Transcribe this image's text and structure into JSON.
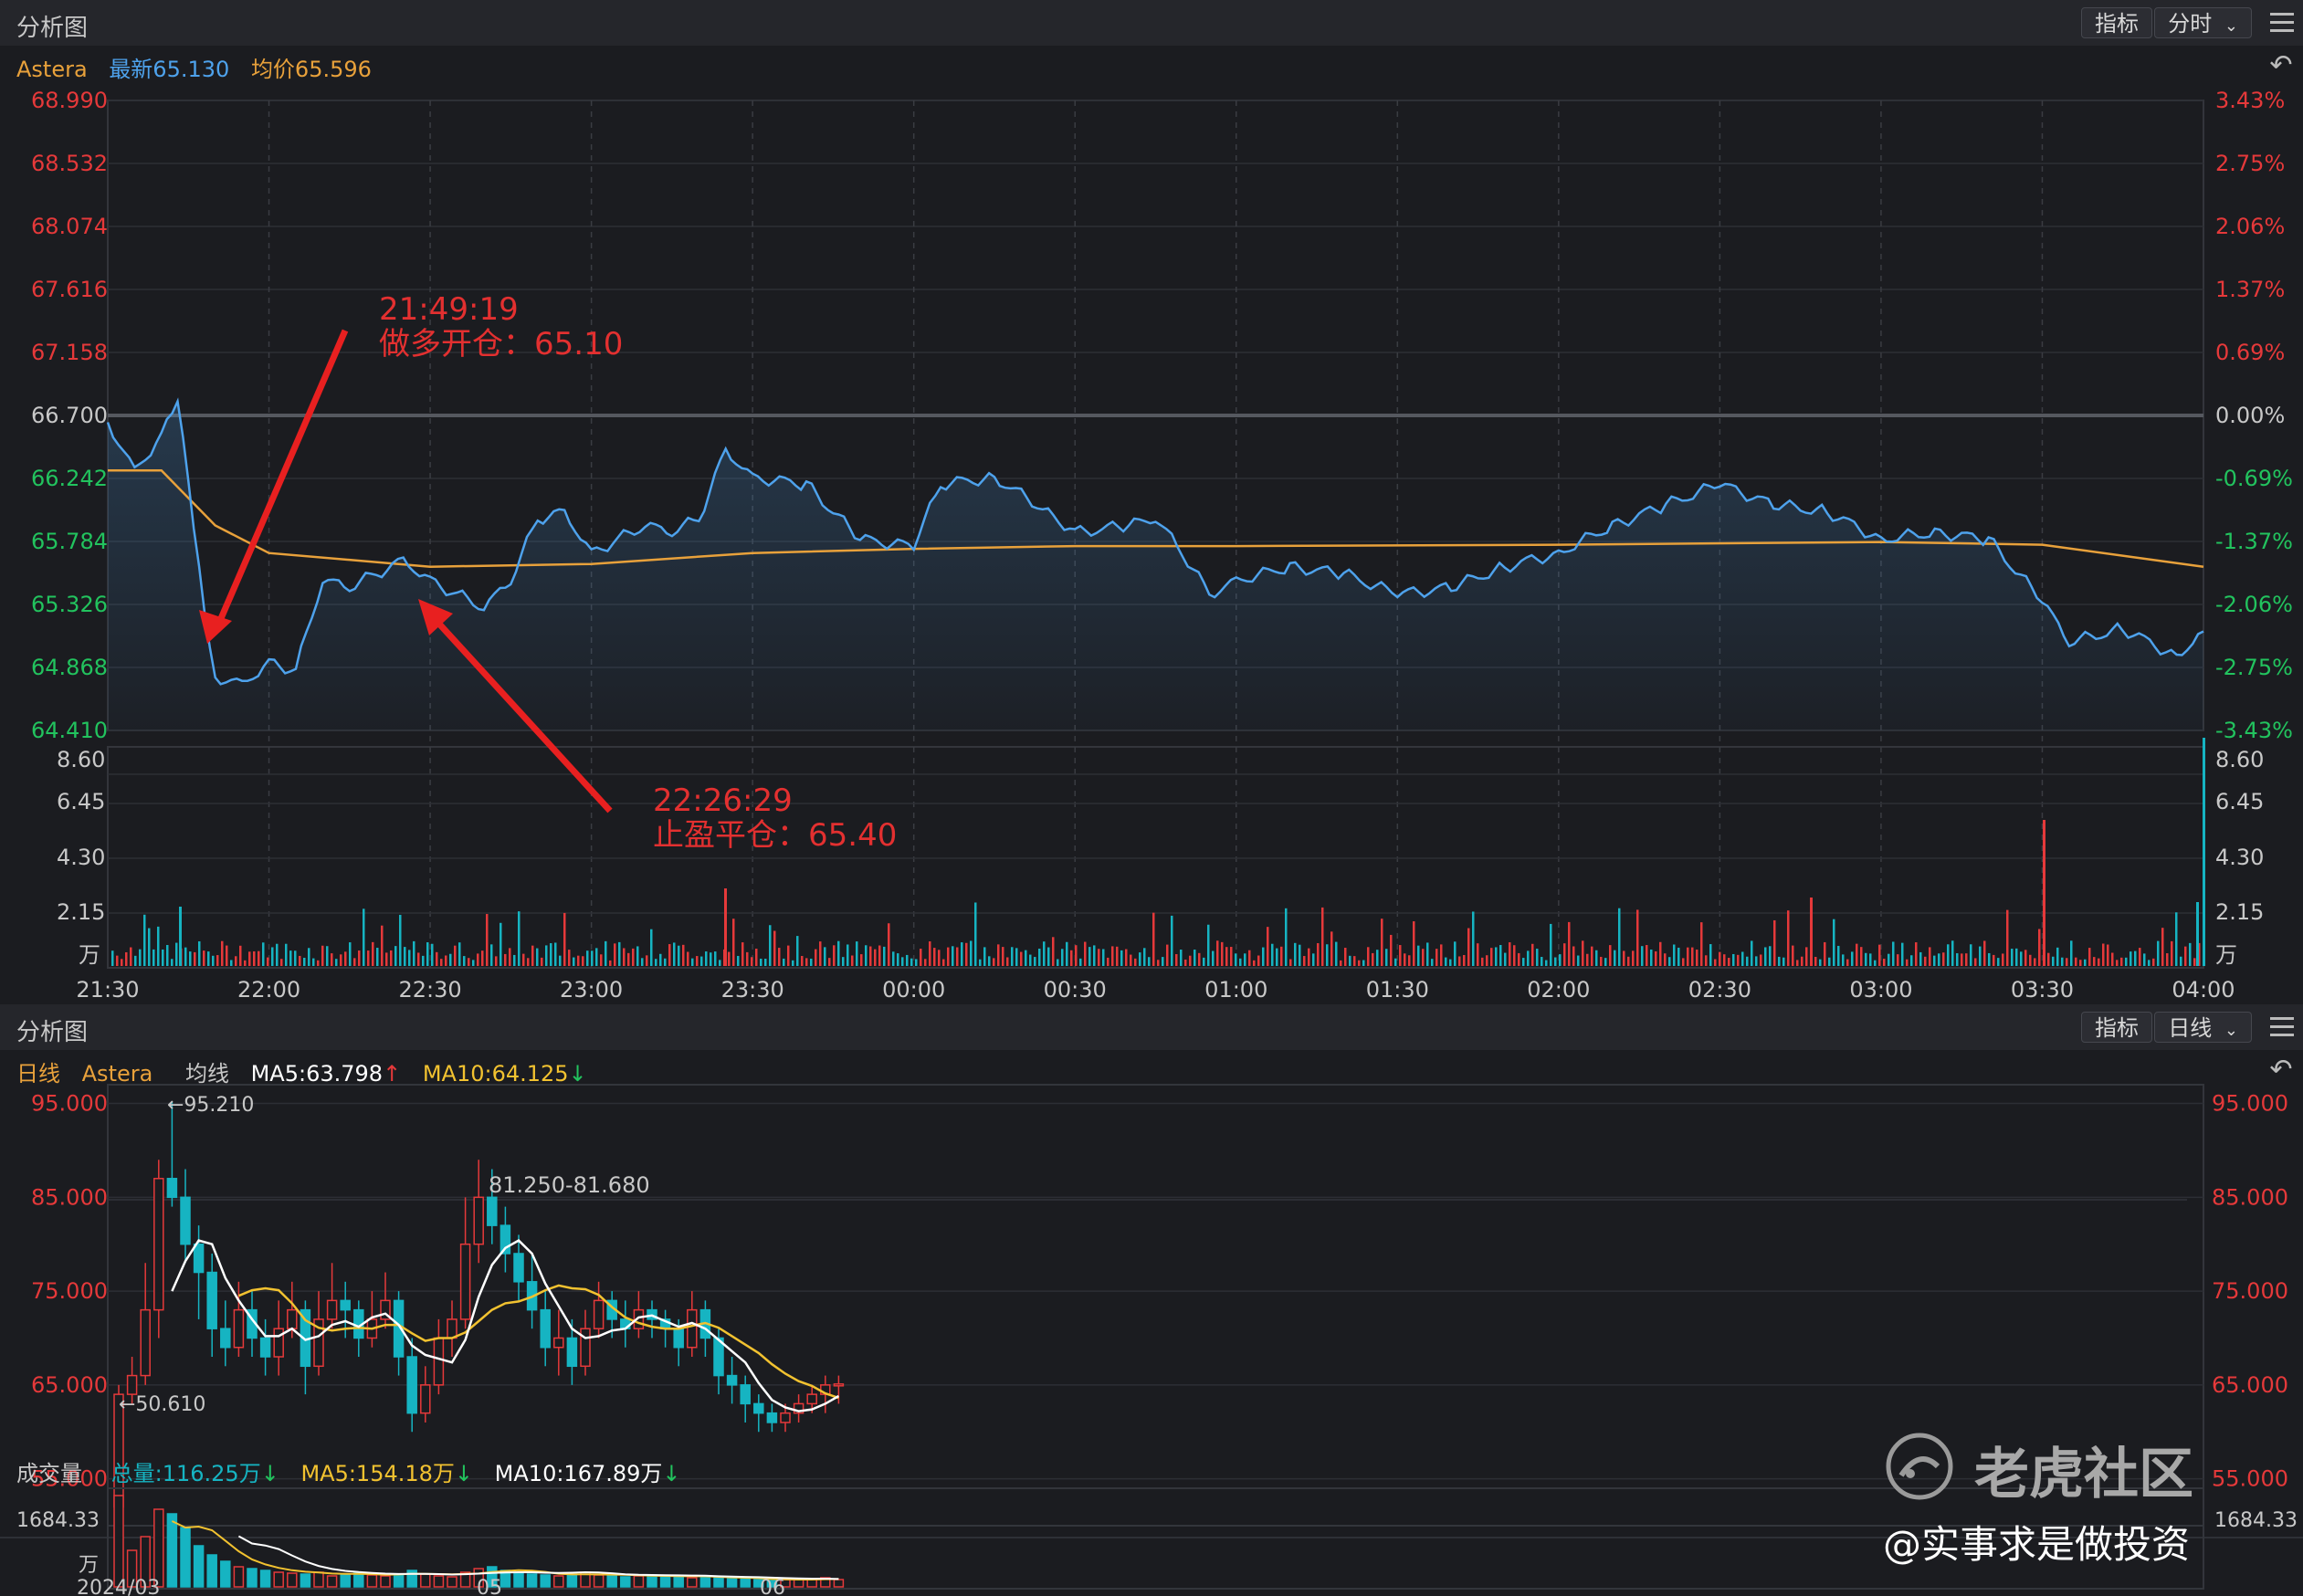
{
  "top_panel": {
    "title": "分析图",
    "indicator_button": "指标",
    "period_select": "分时",
    "legend": {
      "symbol": "Astera",
      "latest": "最新65.130",
      "avg": "均价65.596"
    },
    "price_ticks": [
      "68.990",
      "68.532",
      "68.074",
      "67.616",
      "67.158",
      "66.700",
      "66.242",
      "65.784",
      "65.326",
      "64.868",
      "64.410"
    ],
    "pct_ticks": [
      "3.43%",
      "2.75%",
      "2.06%",
      "1.37%",
      "0.69%",
      "0.00%",
      "-0.69%",
      "-1.37%",
      "-2.06%",
      "-2.75%",
      "-3.43%"
    ],
    "volume_ticks": [
      "8.60",
      "6.45",
      "4.30",
      "2.15",
      "万"
    ],
    "time_ticks": [
      "21:30",
      "22:00",
      "22:30",
      "23:00",
      "23:30",
      "00:00",
      "00:30",
      "01:00",
      "01:30",
      "02:00",
      "02:30",
      "03:00",
      "03:30",
      "04:00"
    ],
    "annotation_entry": {
      "time": "21:49:19",
      "text": "做多开仓：65.10"
    },
    "annotation_exit": {
      "time": "22:26:29",
      "text": "止盈平仓：65.40"
    }
  },
  "bottom_panel": {
    "title": "分析图",
    "indicator_button": "指标",
    "period_select": "日线",
    "legend": {
      "period": "日线",
      "symbol": "Astera",
      "avg_line": "均线",
      "ma5": "MA5:63.798",
      "ma10": "MA10:64.125"
    },
    "price_ticks": [
      "95.000",
      "85.000",
      "75.000",
      "65.000",
      "55.000"
    ],
    "high_label": "←95.210",
    "low_label": "←50.610",
    "range_label": "81.250-81.680",
    "volume_header": {
      "title": "成交量",
      "total": "总量:116.25万",
      "ma5": "MA5:154.18万",
      "ma10": "MA10:167.89万"
    },
    "volume_ticks": [
      "1684.33",
      "万"
    ],
    "date_ticks": [
      "2024/03",
      "05",
      "06"
    ]
  },
  "watermark": {
    "brand": "老虎社区",
    "author": "@实事求是做投资"
  },
  "colors": {
    "up": "#e5393a",
    "down": "#16b4c2",
    "price_line": "#4ea2ec",
    "avg_line": "#e8a13b",
    "ma5": "#ffffff",
    "ma10": "#f2c230",
    "annotation": "#e33030"
  },
  "chart_data": [
    {
      "type": "line",
      "title": "",
      "x_range": [
        "21:30",
        "04:00"
      ],
      "ylim": [
        64.41,
        68.99
      ],
      "series": [
        {
          "name": "最新",
          "points": [
            [
              "21:30",
              66.65
            ],
            [
              "21:35",
              66.3
            ],
            [
              "21:40",
              66.55
            ],
            [
              "21:43",
              66.8
            ],
            [
              "21:46",
              65.9
            ],
            [
              "21:48",
              65.3
            ],
            [
              "21:50",
              64.8
            ],
            [
              "21:55",
              64.75
            ],
            [
              "22:00",
              64.9
            ],
            [
              "22:05",
              64.85
            ],
            [
              "22:10",
              65.5
            ],
            [
              "22:15",
              65.45
            ],
            [
              "22:20",
              65.55
            ],
            [
              "22:25",
              65.65
            ],
            [
              "22:30",
              65.5
            ],
            [
              "22:35",
              65.4
            ],
            [
              "22:40",
              65.3
            ],
            [
              "22:45",
              65.5
            ],
            [
              "22:50",
              65.95
            ],
            [
              "22:55",
              66.0
            ],
            [
              "23:00",
              65.7
            ],
            [
              "23:05",
              65.8
            ],
            [
              "23:10",
              65.9
            ],
            [
              "23:15",
              65.85
            ],
            [
              "23:20",
              65.95
            ],
            [
              "23:25",
              66.45
            ],
            [
              "23:30",
              66.25
            ],
            [
              "23:40",
              66.2
            ],
            [
              "23:50",
              65.8
            ],
            [
              "00:00",
              65.75
            ],
            [
              "00:05",
              66.2
            ],
            [
              "00:15",
              66.25
            ],
            [
              "00:25",
              66.0
            ],
            [
              "00:30",
              65.85
            ],
            [
              "00:40",
              65.9
            ],
            [
              "00:45",
              65.95
            ],
            [
              "00:50",
              65.7
            ],
            [
              "00:55",
              65.4
            ],
            [
              "01:00",
              65.5
            ],
            [
              "01:10",
              65.6
            ],
            [
              "01:20",
              65.55
            ],
            [
              "01:30",
              65.4
            ],
            [
              "01:40",
              65.45
            ],
            [
              "01:50",
              65.6
            ],
            [
              "02:00",
              65.7
            ],
            [
              "02:10",
              65.9
            ],
            [
              "02:20",
              66.05
            ],
            [
              "02:30",
              66.2
            ],
            [
              "02:40",
              66.05
            ],
            [
              "02:50",
              66.0
            ],
            [
              "03:00",
              65.8
            ],
            [
              "03:10",
              65.85
            ],
            [
              "03:20",
              65.8
            ],
            [
              "03:30",
              65.35
            ],
            [
              "03:35",
              65.05
            ],
            [
              "03:45",
              65.15
            ],
            [
              "03:55",
              64.95
            ],
            [
              "04:00",
              65.13
            ]
          ]
        },
        {
          "name": "均价",
          "points": [
            [
              "21:30",
              66.3
            ],
            [
              "21:40",
              66.3
            ],
            [
              "21:50",
              65.9
            ],
            [
              "22:00",
              65.7
            ],
            [
              "22:30",
              65.6
            ],
            [
              "23:00",
              65.62
            ],
            [
              "23:30",
              65.7
            ],
            [
              "00:00",
              65.73
            ],
            [
              "00:30",
              65.75
            ],
            [
              "01:00",
              65.75
            ],
            [
              "02:00",
              65.76
            ],
            [
              "03:00",
              65.78
            ],
            [
              "03:30",
              65.76
            ],
            [
              "04:00",
              65.6
            ]
          ]
        }
      ]
    },
    {
      "type": "candlestick",
      "title": "",
      "ylim": [
        50,
        97
      ],
      "candles": [
        [
          52,
          64,
          50.6,
          65
        ],
        [
          64,
          66,
          63,
          68
        ],
        [
          66,
          73,
          65,
          78
        ],
        [
          73,
          87,
          70,
          89
        ],
        [
          87,
          85,
          84,
          95.2
        ],
        [
          85,
          80,
          78,
          88
        ],
        [
          80,
          77,
          72,
          82
        ],
        [
          77,
          71,
          68,
          79
        ],
        [
          71,
          69,
          67,
          74
        ],
        [
          69,
          73,
          68,
          76
        ],
        [
          73,
          70,
          68,
          75
        ],
        [
          70,
          68,
          66,
          72
        ],
        [
          68,
          71,
          66,
          74
        ],
        [
          71,
          73,
          70,
          76
        ],
        [
          73,
          67,
          64,
          74
        ],
        [
          67,
          72,
          66,
          75
        ],
        [
          72,
          74,
          71,
          78
        ],
        [
          74,
          73,
          70,
          76
        ],
        [
          73,
          70,
          68,
          74
        ],
        [
          70,
          72,
          69,
          75
        ],
        [
          72,
          74,
          71,
          77
        ],
        [
          74,
          68,
          66,
          75
        ],
        [
          68,
          62,
          60,
          70
        ],
        [
          62,
          65,
          61,
          67
        ],
        [
          65,
          70,
          64,
          72
        ],
        [
          70,
          72,
          68,
          74
        ],
        [
          72,
          80,
          71,
          85
        ],
        [
          80,
          85,
          78,
          89
        ],
        [
          85,
          82,
          80,
          88
        ],
        [
          82,
          79,
          77,
          84
        ],
        [
          79,
          76,
          74,
          81
        ],
        [
          76,
          73,
          71,
          79
        ],
        [
          73,
          69,
          67,
          75
        ],
        [
          69,
          70,
          66,
          73
        ],
        [
          70,
          67,
          65,
          72
        ],
        [
          67,
          71,
          66,
          73
        ],
        [
          71,
          74,
          70,
          76
        ],
        [
          74,
          72,
          70,
          75
        ],
        [
          72,
          71,
          69,
          74
        ],
        [
          71,
          73,
          70,
          75
        ],
        [
          73,
          72,
          70,
          74
        ],
        [
          72,
          71,
          69,
          73
        ],
        [
          71,
          69,
          67,
          72
        ],
        [
          69,
          73,
          68,
          75
        ],
        [
          73,
          70,
          68,
          74
        ],
        [
          70,
          66,
          64,
          71
        ],
        [
          66,
          65,
          63,
          68
        ],
        [
          65,
          63,
          61,
          66
        ],
        [
          63,
          62,
          60,
          64
        ],
        [
          62,
          61,
          60,
          63
        ],
        [
          61,
          62,
          60,
          63
        ],
        [
          62,
          63,
          61,
          64
        ],
        [
          63,
          64,
          62,
          65
        ],
        [
          64,
          65,
          62,
          66
        ],
        [
          65,
          65.1,
          63,
          66
        ]
      ],
      "annotations": [
        "←95.210",
        "←50.610",
        "81.250-81.680"
      ]
    }
  ]
}
